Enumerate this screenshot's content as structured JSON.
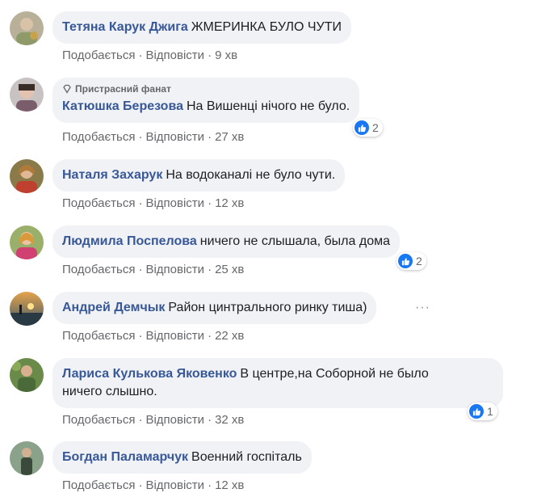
{
  "colors": {
    "name": "#385898",
    "bubble": "#f0f2f5",
    "meta": "#65676b",
    "like": "#1877f2"
  },
  "actions": {
    "like": "Подобається",
    "reply": "Відповісти",
    "separator": "·"
  },
  "comments": [
    {
      "author": "Тетяна Карук Джига",
      "text": "ЖМЕРИНКА БУЛО ЧУТИ",
      "time": "9 хв"
    },
    {
      "badge": "Пристрасний фанат",
      "badge_icon": "diamond-icon",
      "author": "Катюшка Березова",
      "text": "На Вишенці нічого не було.",
      "time": "27 хв",
      "reactions": "2"
    },
    {
      "author": "Наталя Захарук",
      "text": "На водоканалі не було чути.",
      "time": "12 хв"
    },
    {
      "author": "Людмила Поспелова",
      "text": "ничего не слышала, была дома",
      "time": "25 хв",
      "reactions": "2"
    },
    {
      "author": "Андрей Демчык",
      "text": "Район цинтрального ринку тиша)",
      "time": "22 хв",
      "more": "···"
    },
    {
      "author": "Лариса Кулькова Яковенко",
      "text_line1": "В центре,на Соборной не было",
      "text_line2": "ничего слышно.",
      "time": "32 хв",
      "reactions": "1"
    },
    {
      "author": "Богдан Паламарчук",
      "text": "Военний госпіталь",
      "time": "12 хв"
    }
  ]
}
